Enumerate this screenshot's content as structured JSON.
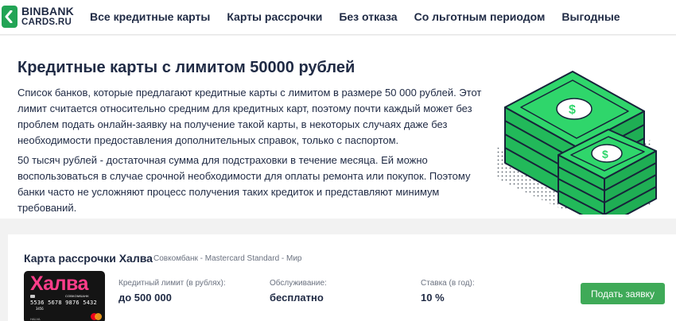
{
  "header": {
    "logo_line1": "BINBANK",
    "logo_line2": "CARDS.RU",
    "nav": [
      {
        "label": "Все кредитные карты"
      },
      {
        "label": "Карты рассрочки"
      },
      {
        "label": "Без отказа"
      },
      {
        "label": "Со льготным периодом"
      },
      {
        "label": "Выгодные"
      }
    ]
  },
  "hero": {
    "title": "Кредитные карты с лимитом 50000 рублей",
    "paragraph1": "Список банков, которые предлагают кредитные карты с лимитом в размере 50 000 рублей. Этот лимит считается относительно средним для кредитных карт, поэтому почти каждый может без проблем подать онлайн-заявку на получение такой карты, в некоторых случаях даже без необходимости предоставления дополнительных справок, только с паспортом.",
    "paragraph2": "50 тысяч рублей - достаточная сумма для подстраховки в течение месяца. Ей можно воспользоваться в случае срочной необходимости для оплаты ремонта или покупок. Поэтому банки часто не усложняют процесс получения таких кредиток и представляют минимум требований.",
    "illustration": "money-stack-icon"
  },
  "offer": {
    "title": "Карта рассрочки Халва",
    "subtitle": "Совкомбанк - Mastercard Standard - Мир",
    "card": {
      "brand": "Халва",
      "bank": "СОВКОМБАНК",
      "number": "5536 5678 9876 5432",
      "code": "3456",
      "holder": "HALVA"
    },
    "limit_label": "Кредитный лимит (в рублях):",
    "limit_value": "до 500 000",
    "service_label": "Обслуживание:",
    "service_value": "бесплатно",
    "rate_label": "Ставка (в год):",
    "rate_value": "10 %",
    "apply_label": "Подать заявку"
  },
  "colors": {
    "brand_green": "#22a455",
    "button_green": "#3faa58",
    "text_dark": "#1f2a44",
    "money_green": "#2fd66b",
    "card_pink": "#ff3d8a"
  }
}
